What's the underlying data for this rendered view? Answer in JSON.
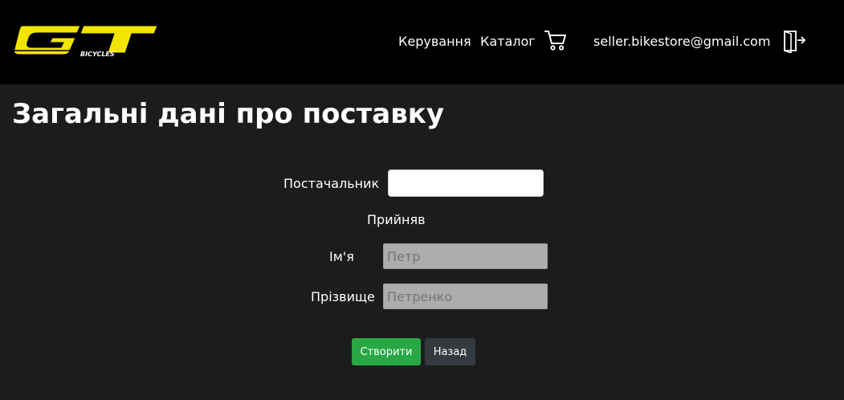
{
  "header": {
    "logo_text": "GT",
    "logo_subtext": "BICYCLES",
    "nav": {
      "manage": "Керування",
      "catalog": "Каталог"
    },
    "cart_icon": "cart-icon",
    "user_email": "seller.bikestore@gmail.com",
    "logout_icon": "logout-icon"
  },
  "page": {
    "title": "Загальні дані про поставку"
  },
  "form": {
    "supplier_label": "Постачальник",
    "supplier_value": "",
    "accepted_label": "Прийняв",
    "firstname_label": "Ім'я",
    "firstname_placeholder": "Петр",
    "lastname_label": "Прізвище",
    "lastname_placeholder": "Петренко",
    "create_button": "Створити",
    "back_button": "Назад"
  },
  "colors": {
    "header_bg": "#000000",
    "page_bg": "#1c1c1c",
    "logo_yellow": "#f2e600",
    "create_button": "#28a745",
    "back_button": "#343a40",
    "readonly_input": "#adadad"
  }
}
